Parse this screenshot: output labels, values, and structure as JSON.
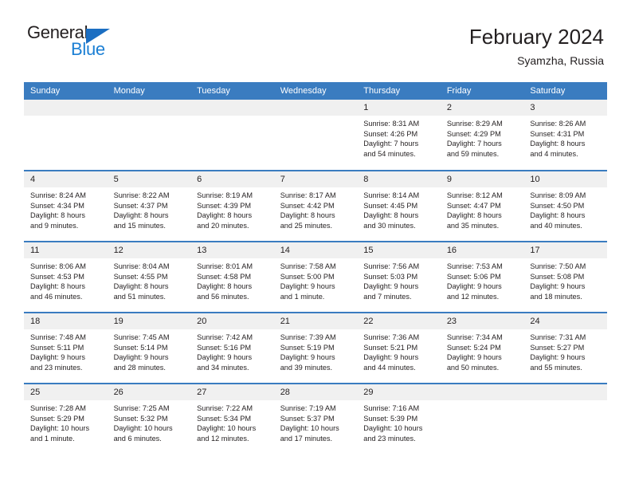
{
  "logo": {
    "word_top": "General",
    "word_bottom": "Blue",
    "triangle_color": "#1b6ec2",
    "blue_color": "#1b7fd4"
  },
  "header": {
    "title": "February 2024",
    "subtitle": "Syamzha, Russia"
  },
  "colors": {
    "header_row": "#3a7cc0",
    "daynum_band": "#f0f0f0",
    "text": "#231f20"
  },
  "weekdays": [
    "Sunday",
    "Monday",
    "Tuesday",
    "Wednesday",
    "Thursday",
    "Friday",
    "Saturday"
  ],
  "weeks": [
    [
      {
        "day": "",
        "blank": true,
        "sunrise": "",
        "sunset": "",
        "daylight1": "",
        "daylight2": ""
      },
      {
        "day": "",
        "blank": true,
        "sunrise": "",
        "sunset": "",
        "daylight1": "",
        "daylight2": ""
      },
      {
        "day": "",
        "blank": true,
        "sunrise": "",
        "sunset": "",
        "daylight1": "",
        "daylight2": ""
      },
      {
        "day": "",
        "blank": true,
        "sunrise": "",
        "sunset": "",
        "daylight1": "",
        "daylight2": ""
      },
      {
        "day": "1",
        "sunrise": "Sunrise: 8:31 AM",
        "sunset": "Sunset: 4:26 PM",
        "daylight1": "Daylight: 7 hours",
        "daylight2": "and 54 minutes."
      },
      {
        "day": "2",
        "sunrise": "Sunrise: 8:29 AM",
        "sunset": "Sunset: 4:29 PM",
        "daylight1": "Daylight: 7 hours",
        "daylight2": "and 59 minutes."
      },
      {
        "day": "3",
        "sunrise": "Sunrise: 8:26 AM",
        "sunset": "Sunset: 4:31 PM",
        "daylight1": "Daylight: 8 hours",
        "daylight2": "and 4 minutes."
      }
    ],
    [
      {
        "day": "4",
        "sunrise": "Sunrise: 8:24 AM",
        "sunset": "Sunset: 4:34 PM",
        "daylight1": "Daylight: 8 hours",
        "daylight2": "and 9 minutes."
      },
      {
        "day": "5",
        "sunrise": "Sunrise: 8:22 AM",
        "sunset": "Sunset: 4:37 PM",
        "daylight1": "Daylight: 8 hours",
        "daylight2": "and 15 minutes."
      },
      {
        "day": "6",
        "sunrise": "Sunrise: 8:19 AM",
        "sunset": "Sunset: 4:39 PM",
        "daylight1": "Daylight: 8 hours",
        "daylight2": "and 20 minutes."
      },
      {
        "day": "7",
        "sunrise": "Sunrise: 8:17 AM",
        "sunset": "Sunset: 4:42 PM",
        "daylight1": "Daylight: 8 hours",
        "daylight2": "and 25 minutes."
      },
      {
        "day": "8",
        "sunrise": "Sunrise: 8:14 AM",
        "sunset": "Sunset: 4:45 PM",
        "daylight1": "Daylight: 8 hours",
        "daylight2": "and 30 minutes."
      },
      {
        "day": "9",
        "sunrise": "Sunrise: 8:12 AM",
        "sunset": "Sunset: 4:47 PM",
        "daylight1": "Daylight: 8 hours",
        "daylight2": "and 35 minutes."
      },
      {
        "day": "10",
        "sunrise": "Sunrise: 8:09 AM",
        "sunset": "Sunset: 4:50 PM",
        "daylight1": "Daylight: 8 hours",
        "daylight2": "and 40 minutes."
      }
    ],
    [
      {
        "day": "11",
        "sunrise": "Sunrise: 8:06 AM",
        "sunset": "Sunset: 4:53 PM",
        "daylight1": "Daylight: 8 hours",
        "daylight2": "and 46 minutes."
      },
      {
        "day": "12",
        "sunrise": "Sunrise: 8:04 AM",
        "sunset": "Sunset: 4:55 PM",
        "daylight1": "Daylight: 8 hours",
        "daylight2": "and 51 minutes."
      },
      {
        "day": "13",
        "sunrise": "Sunrise: 8:01 AM",
        "sunset": "Sunset: 4:58 PM",
        "daylight1": "Daylight: 8 hours",
        "daylight2": "and 56 minutes."
      },
      {
        "day": "14",
        "sunrise": "Sunrise: 7:58 AM",
        "sunset": "Sunset: 5:00 PM",
        "daylight1": "Daylight: 9 hours",
        "daylight2": "and 1 minute."
      },
      {
        "day": "15",
        "sunrise": "Sunrise: 7:56 AM",
        "sunset": "Sunset: 5:03 PM",
        "daylight1": "Daylight: 9 hours",
        "daylight2": "and 7 minutes."
      },
      {
        "day": "16",
        "sunrise": "Sunrise: 7:53 AM",
        "sunset": "Sunset: 5:06 PM",
        "daylight1": "Daylight: 9 hours",
        "daylight2": "and 12 minutes."
      },
      {
        "day": "17",
        "sunrise": "Sunrise: 7:50 AM",
        "sunset": "Sunset: 5:08 PM",
        "daylight1": "Daylight: 9 hours",
        "daylight2": "and 18 minutes."
      }
    ],
    [
      {
        "day": "18",
        "sunrise": "Sunrise: 7:48 AM",
        "sunset": "Sunset: 5:11 PM",
        "daylight1": "Daylight: 9 hours",
        "daylight2": "and 23 minutes."
      },
      {
        "day": "19",
        "sunrise": "Sunrise: 7:45 AM",
        "sunset": "Sunset: 5:14 PM",
        "daylight1": "Daylight: 9 hours",
        "daylight2": "and 28 minutes."
      },
      {
        "day": "20",
        "sunrise": "Sunrise: 7:42 AM",
        "sunset": "Sunset: 5:16 PM",
        "daylight1": "Daylight: 9 hours",
        "daylight2": "and 34 minutes."
      },
      {
        "day": "21",
        "sunrise": "Sunrise: 7:39 AM",
        "sunset": "Sunset: 5:19 PM",
        "daylight1": "Daylight: 9 hours",
        "daylight2": "and 39 minutes."
      },
      {
        "day": "22",
        "sunrise": "Sunrise: 7:36 AM",
        "sunset": "Sunset: 5:21 PM",
        "daylight1": "Daylight: 9 hours",
        "daylight2": "and 44 minutes."
      },
      {
        "day": "23",
        "sunrise": "Sunrise: 7:34 AM",
        "sunset": "Sunset: 5:24 PM",
        "daylight1": "Daylight: 9 hours",
        "daylight2": "and 50 minutes."
      },
      {
        "day": "24",
        "sunrise": "Sunrise: 7:31 AM",
        "sunset": "Sunset: 5:27 PM",
        "daylight1": "Daylight: 9 hours",
        "daylight2": "and 55 minutes."
      }
    ],
    [
      {
        "day": "25",
        "sunrise": "Sunrise: 7:28 AM",
        "sunset": "Sunset: 5:29 PM",
        "daylight1": "Daylight: 10 hours",
        "daylight2": "and 1 minute."
      },
      {
        "day": "26",
        "sunrise": "Sunrise: 7:25 AM",
        "sunset": "Sunset: 5:32 PM",
        "daylight1": "Daylight: 10 hours",
        "daylight2": "and 6 minutes."
      },
      {
        "day": "27",
        "sunrise": "Sunrise: 7:22 AM",
        "sunset": "Sunset: 5:34 PM",
        "daylight1": "Daylight: 10 hours",
        "daylight2": "and 12 minutes."
      },
      {
        "day": "28",
        "sunrise": "Sunrise: 7:19 AM",
        "sunset": "Sunset: 5:37 PM",
        "daylight1": "Daylight: 10 hours",
        "daylight2": "and 17 minutes."
      },
      {
        "day": "29",
        "sunrise": "Sunrise: 7:16 AM",
        "sunset": "Sunset: 5:39 PM",
        "daylight1": "Daylight: 10 hours",
        "daylight2": "and 23 minutes."
      },
      {
        "day": "",
        "blank": true,
        "sunrise": "",
        "sunset": "",
        "daylight1": "",
        "daylight2": ""
      },
      {
        "day": "",
        "blank": true,
        "sunrise": "",
        "sunset": "",
        "daylight1": "",
        "daylight2": ""
      }
    ]
  ]
}
